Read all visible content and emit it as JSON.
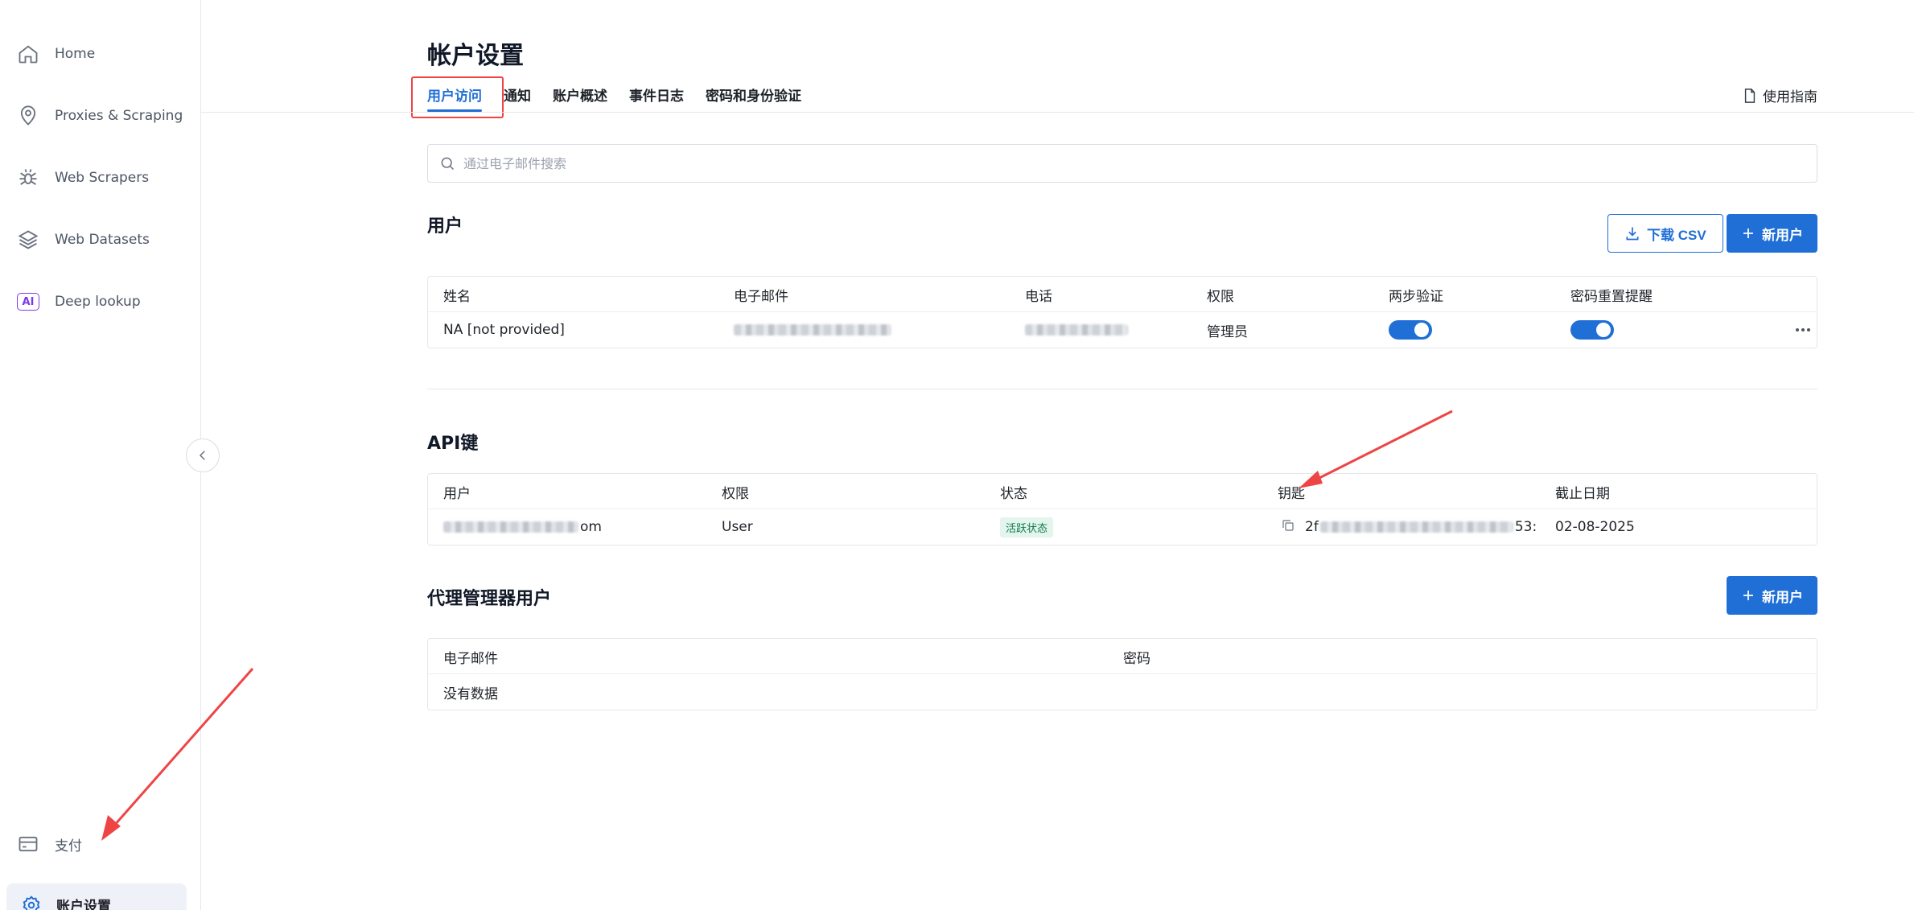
{
  "sidebar": {
    "items": [
      {
        "label": "Home",
        "icon": "home-icon"
      },
      {
        "label": "Proxies & Scraping",
        "icon": "location-pin-icon"
      },
      {
        "label": "Web Scrapers",
        "icon": "spider-icon"
      },
      {
        "label": "Web Datasets",
        "icon": "layers-icon"
      },
      {
        "label": "Deep lookup",
        "icon": "ai-badge-icon",
        "badge": "AI"
      }
    ],
    "billing": {
      "label": "支付",
      "icon": "card-icon"
    },
    "account": {
      "label": "账户设置",
      "icon": "gear-icon"
    }
  },
  "header": {
    "title": "帐户设置",
    "tabs": [
      {
        "label": "用户访问",
        "active": true
      },
      {
        "label": "通知"
      },
      {
        "label": "账户概述"
      },
      {
        "label": "事件日志"
      },
      {
        "label": "密码和身份验证"
      }
    ],
    "guide_label": "使用指南"
  },
  "search": {
    "placeholder": "通过电子邮件搜索",
    "value": ""
  },
  "users": {
    "title": "用户",
    "download_label": "下载 CSV",
    "new_user_label": "新用户",
    "columns": [
      "姓名",
      "电子邮件",
      "电话",
      "权限",
      "两步验证",
      "密码重置提醒"
    ],
    "rows": [
      {
        "name": "NA [not provided]",
        "permission": "管理员",
        "two_factor": true,
        "reset_reminder": true
      }
    ]
  },
  "api_keys": {
    "title": "API键",
    "columns": [
      "用户",
      "权限",
      "状态",
      "钥匙",
      "截止日期"
    ],
    "rows": [
      {
        "user_suffix": "om",
        "permission": "User",
        "status": "活跃状态",
        "key_prefix": "2f",
        "key_suffix": "53:",
        "expiry": "02-08-2025"
      }
    ]
  },
  "proxy_users": {
    "title": "代理管理器用户",
    "new_user_label": "新用户",
    "columns": [
      "电子邮件",
      "密码"
    ],
    "empty_text": "没有数据"
  },
  "colors": {
    "accent": "#1f6fd6",
    "active_badge_bg": "#e3f5ec",
    "active_badge_text": "#0f7a4f",
    "annotation": "#ef4444"
  }
}
